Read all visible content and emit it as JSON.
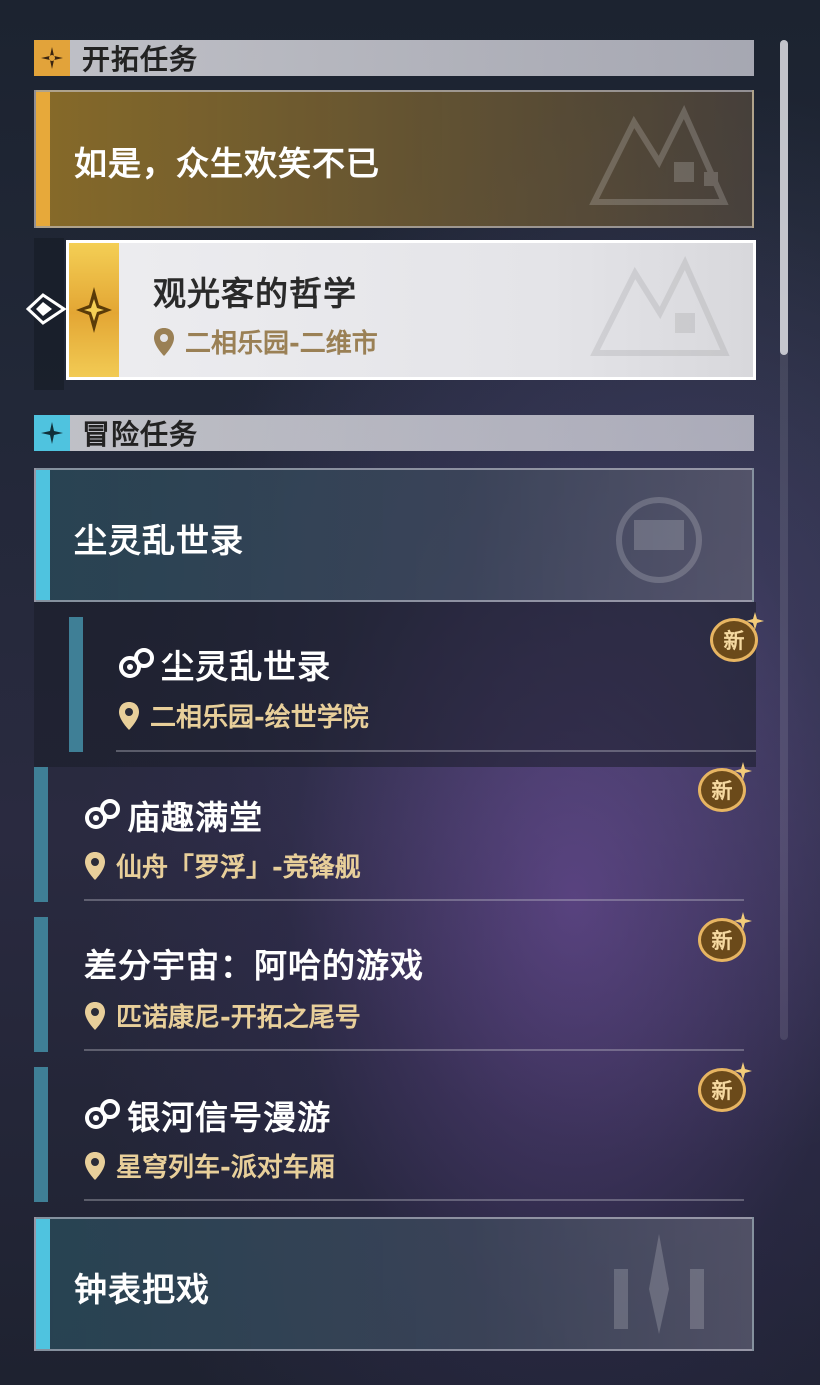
{
  "sections": [
    {
      "title": "开拓任务",
      "icon": "trailblaze-mission-icon"
    },
    {
      "title": "冒险任务",
      "icon": "adventure-mission-icon"
    }
  ],
  "trailblaze": {
    "group_title": "如是，众生欢笑不已",
    "selected_quest": {
      "title": "观光客的哲学",
      "location": "二相乐园-二维市"
    }
  },
  "adventure": {
    "group1_title": "尘灵乱世录",
    "quests": [
      {
        "title": "尘灵乱世录",
        "location": "二相乐园-绘世学院",
        "badge": "新"
      },
      {
        "title": "庙趣满堂",
        "location": "仙舟「罗浮」-竞锋舰",
        "badge": "新"
      },
      {
        "title": "差分宇宙：阿哈的游戏",
        "location": "匹诺康尼-开拓之尾号",
        "badge": "新"
      },
      {
        "title": "银河信号漫游",
        "location": "星穹列车-派对车厢",
        "badge": "新"
      }
    ],
    "group2_title": "钟表把戏"
  },
  "colors": {
    "gold": "#e7b562",
    "cyan_accent": "#4fc3df",
    "location_text": "#e8cf9a"
  }
}
